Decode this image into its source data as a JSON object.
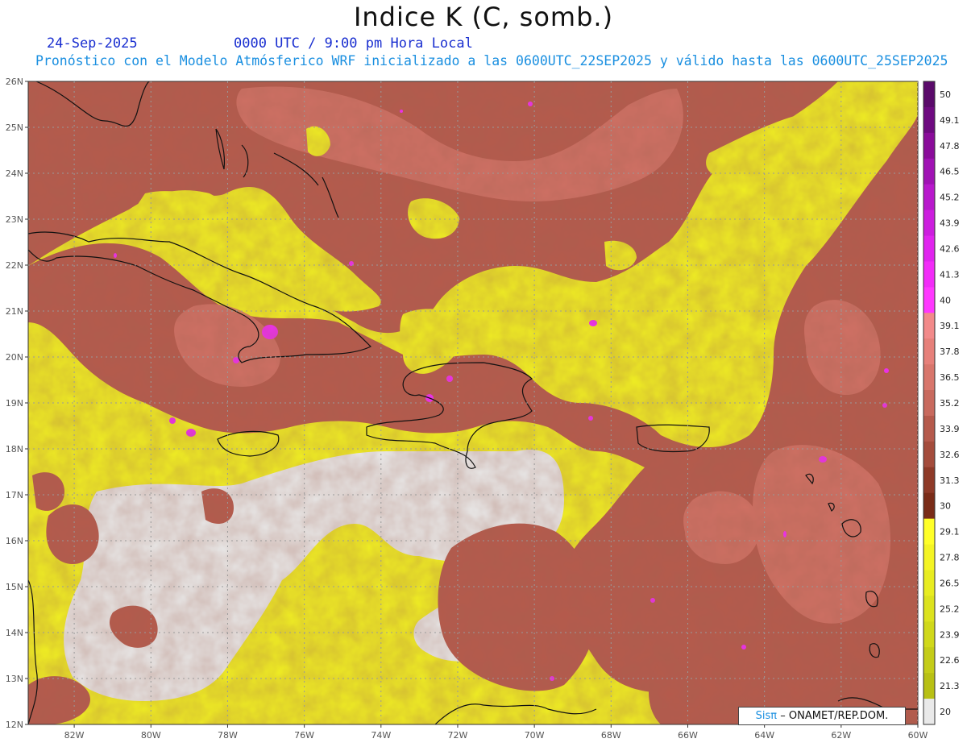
{
  "header": {
    "title": "Indice K (C, somb.)",
    "date": "24-Sep-2025",
    "time": "0000 UTC / 9:00 pm Hora Local",
    "forecast": "Pronóstico con el Modelo Atmósferico WRF inicializado a las 0600UTC_22SEP2025 y válido hasta las  0600UTC_25SEP2025"
  },
  "map": {
    "lat_labels": [
      "26N",
      "25N",
      "24N",
      "23N",
      "22N",
      "21N",
      "20N",
      "19N",
      "18N",
      "17N",
      "16N",
      "15N",
      "14N",
      "13N",
      "12N"
    ],
    "lon_labels": [
      "82W",
      "80W",
      "78W",
      "76W",
      "74W",
      "72W",
      "70W",
      "68W",
      "66W",
      "64W",
      "62W",
      "60W"
    ],
    "lat_range": [
      12,
      26
    ],
    "lon_range": [
      -83.2,
      -60
    ],
    "grid": true,
    "grid_style": "dotted"
  },
  "colorbar": {
    "labels": [
      "50",
      "49.1",
      "47.8",
      "46.5",
      "45.2",
      "43.9",
      "42.6",
      "41.3",
      "40",
      "39.1",
      "37.8",
      "36.5",
      "35.2",
      "33.9",
      "32.6",
      "31.3",
      "30",
      "29.1",
      "27.8",
      "26.5",
      "25.2",
      "23.9",
      "22.6",
      "21.3",
      "20"
    ],
    "colors": [
      "#5a0a6a",
      "#6e0a80",
      "#8a0c9a",
      "#a012b4",
      "#b818cc",
      "#cc1ede",
      "#e024ee",
      "#f22cf8",
      "#ff38ff",
      "#f28a8a",
      "#e6807a",
      "#d8766c",
      "#c86a5e",
      "#b55a4c",
      "#a44c3c",
      "#8e3a28",
      "#7a2c18",
      "#ffff28",
      "#f4f424",
      "#e8ec20",
      "#dce21e",
      "#d0d81a",
      "#c4cc18",
      "#b8c014",
      "#e9e9e9"
    ]
  },
  "credit": {
    "sis": "Sisπ",
    "org": "– ONAMET/REP.DOM."
  }
}
